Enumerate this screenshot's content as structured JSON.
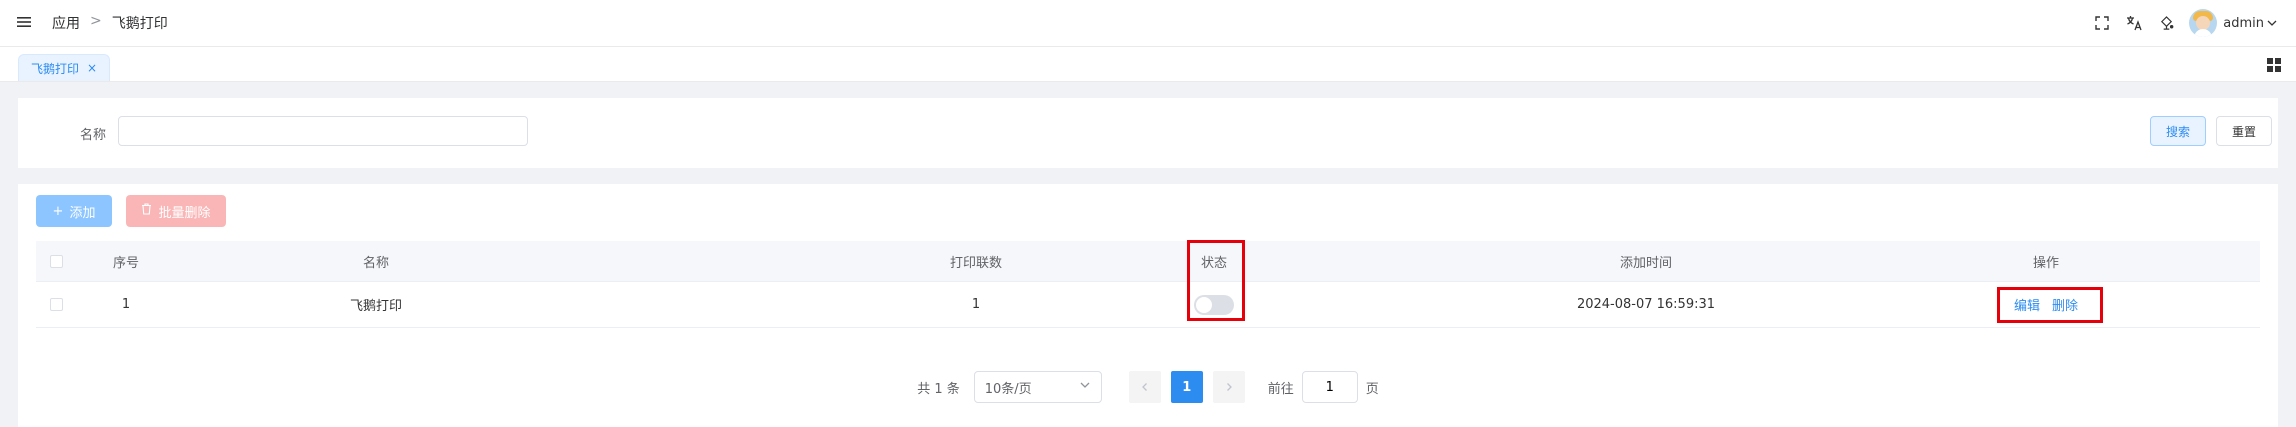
{
  "header": {
    "breadcrumb": [
      "应用",
      "飞鹅打印"
    ],
    "breadcrumb_sep": ">",
    "username": "admin"
  },
  "tabs": [
    {
      "label": "飞鹅打印",
      "close": "×"
    }
  ],
  "search": {
    "name_label": "名称",
    "name_value": "",
    "name_placeholder": "",
    "search_button": "搜索",
    "reset_button": "重置"
  },
  "toolbar": {
    "add_label": "添加",
    "batch_delete_label": "批量删除"
  },
  "table": {
    "columns": [
      "序号",
      "名称",
      "打印联数",
      "状态",
      "添加时间",
      "操作"
    ],
    "rows": [
      {
        "index": "1",
        "name": "飞鹅打印",
        "copies": "1",
        "status_on": false,
        "added": "2024-08-07 16:59:31",
        "edit": "编辑",
        "delete": "删除"
      }
    ]
  },
  "pagination": {
    "total_text": "共 1 条",
    "page_size": "10条/页",
    "current_page": "1",
    "goto_prefix": "前往",
    "goto_value": "1",
    "goto_suffix": "页"
  },
  "colors": {
    "primary": "#2d8cf0",
    "highlight": "#e6000a",
    "danger_light": "#fab6b6"
  }
}
